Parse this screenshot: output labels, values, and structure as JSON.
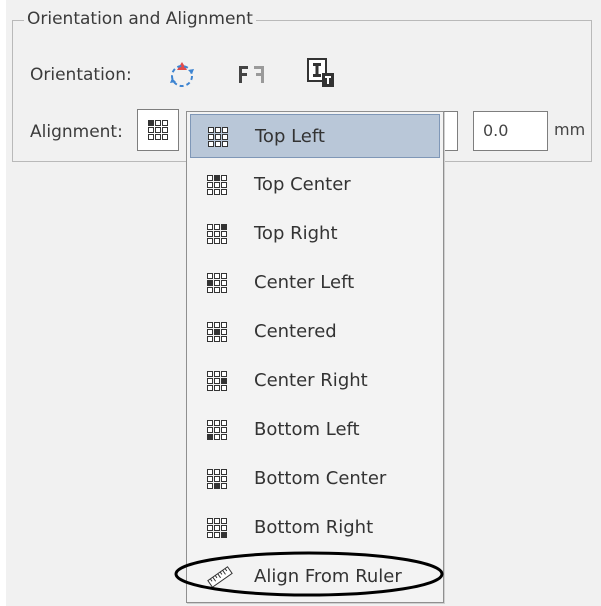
{
  "group": {
    "title": "Orientation and Alignment"
  },
  "orientation": {
    "label": "Orientation:",
    "buttons": [
      "rotate-icon",
      "mirror-icon",
      "text-orientation-icon"
    ]
  },
  "alignment": {
    "label": "Alignment:",
    "offset_value": "0.0",
    "unit": "mm",
    "options": [
      {
        "label": "Top Left",
        "selected": true
      },
      {
        "label": "Top Center",
        "selected": false
      },
      {
        "label": "Top Right",
        "selected": false
      },
      {
        "label": "Center Left",
        "selected": false
      },
      {
        "label": "Centered",
        "selected": false
      },
      {
        "label": "Center Right",
        "selected": false
      },
      {
        "label": "Bottom Left",
        "selected": false
      },
      {
        "label": "Bottom Center",
        "selected": false
      },
      {
        "label": "Bottom Right",
        "selected": false
      },
      {
        "label": "Align From Ruler",
        "selected": false
      }
    ]
  },
  "colors": {
    "selection": "#b9c7d8",
    "highlight": "#000000"
  }
}
